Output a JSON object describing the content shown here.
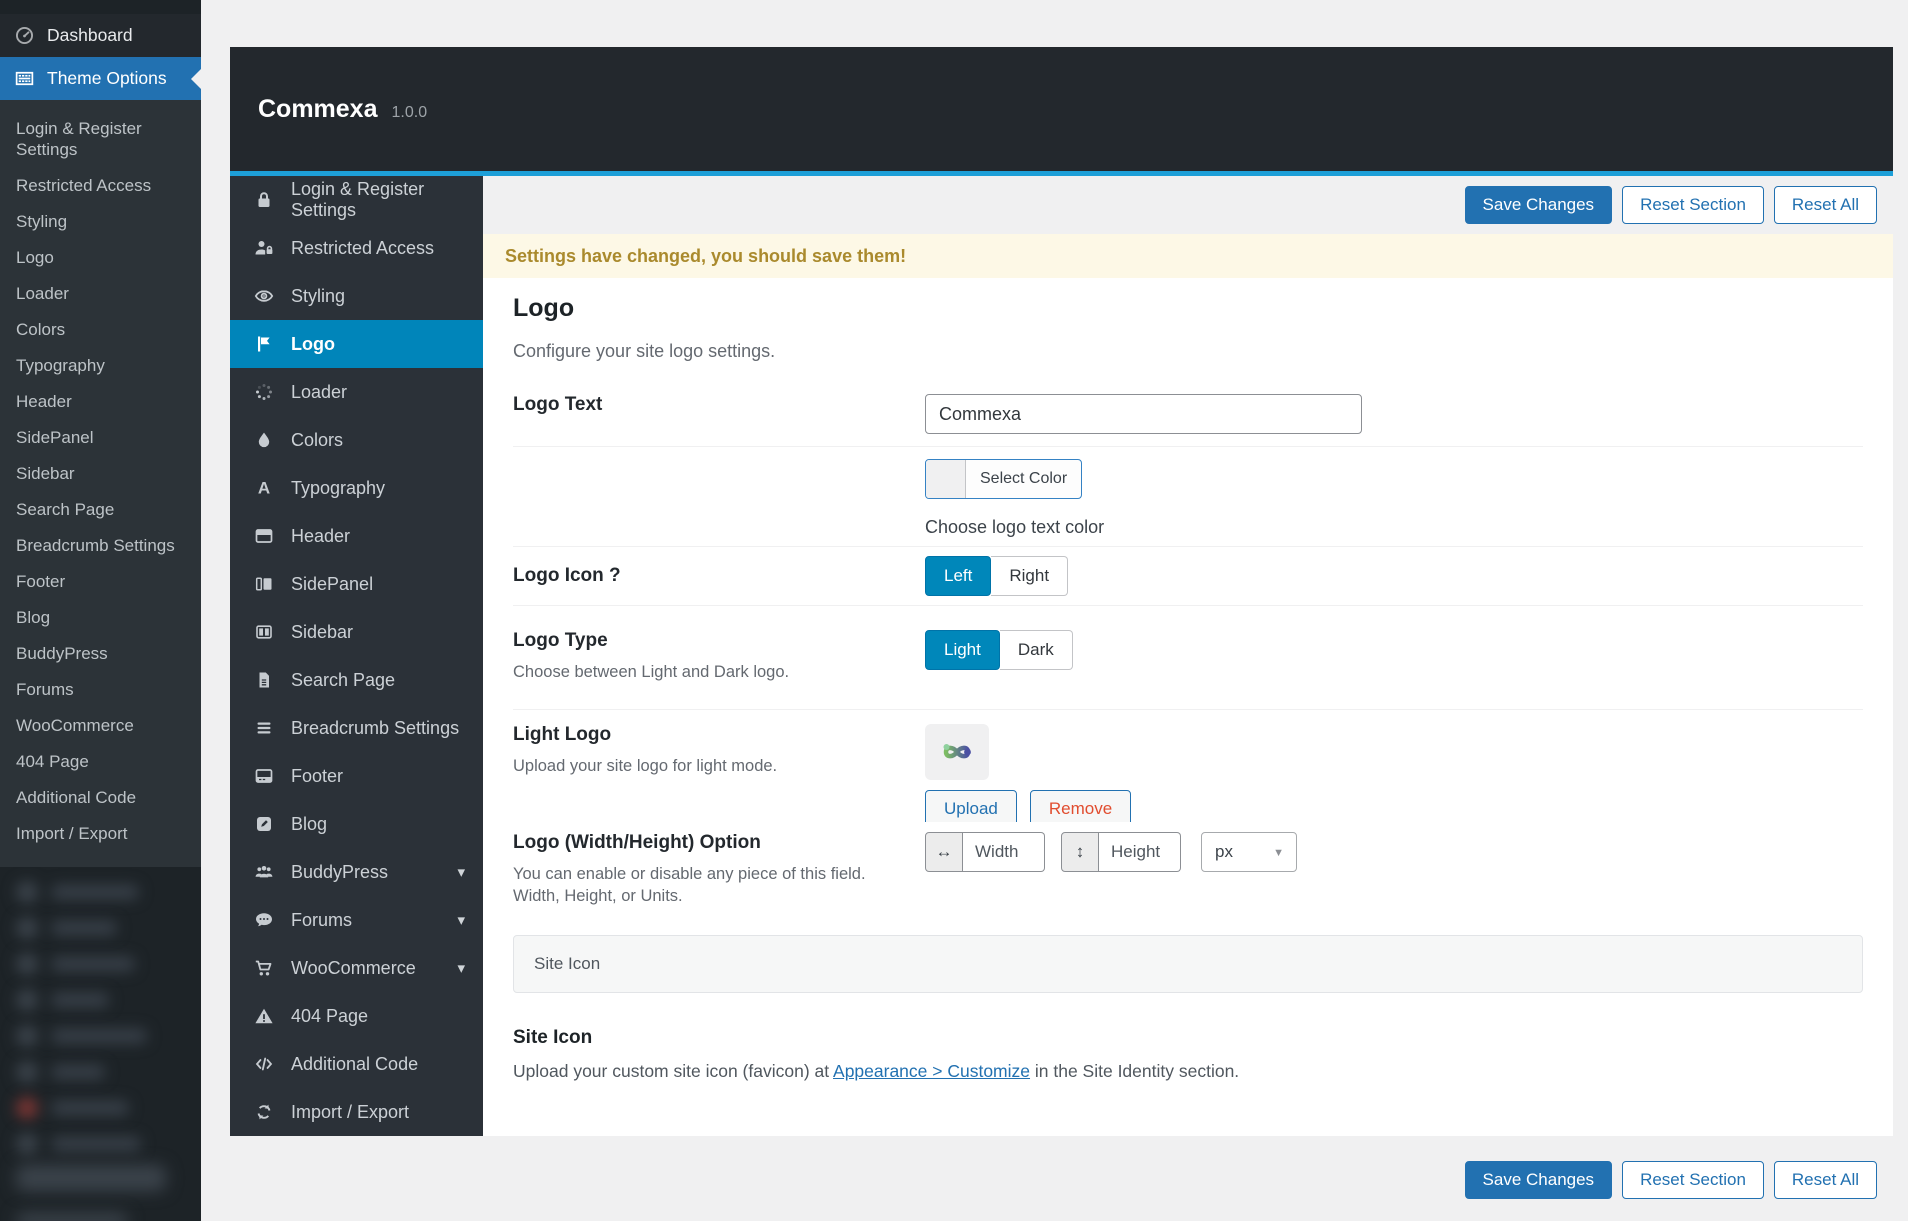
{
  "icons": {
    "chevron_down": "▾",
    "select_caret": "▼",
    "width_arrow": "↔",
    "height_arrow": "↕"
  },
  "admin_sidebar": {
    "dashboard": "Dashboard",
    "theme_options": "Theme Options",
    "submenu": [
      "Login & Register Settings",
      "Restricted Access",
      "Styling",
      "Logo",
      "Loader",
      "Colors",
      "Typography",
      "Header",
      "SidePanel",
      "Sidebar",
      "Search Page",
      "Breadcrumb Settings",
      "Footer",
      "Blog",
      "BuddyPress",
      "Forums",
      "WooCommerce",
      "404 Page",
      "Additional Code",
      "Import / Export"
    ]
  },
  "panel": {
    "title": "Commexa",
    "version": "1.0.0",
    "menu": [
      {
        "label": "Login & Register Settings",
        "icon": "lock-icon"
      },
      {
        "label": "Restricted Access",
        "icon": "user-lock-icon"
      },
      {
        "label": "Styling",
        "icon": "eye-icon"
      },
      {
        "label": "Logo",
        "icon": "flag-icon",
        "active": true
      },
      {
        "label": "Loader",
        "icon": "spinner-icon"
      },
      {
        "label": "Colors",
        "icon": "droplet-icon"
      },
      {
        "label": "Typography",
        "icon": "letter-a-icon"
      },
      {
        "label": "Header",
        "icon": "header-icon"
      },
      {
        "label": "SidePanel",
        "icon": "sidepanel-icon"
      },
      {
        "label": "Sidebar",
        "icon": "sidebar-columns-icon"
      },
      {
        "label": "Search Page",
        "icon": "document-icon"
      },
      {
        "label": "Breadcrumb Settings",
        "icon": "menu-lines-icon"
      },
      {
        "label": "Footer",
        "icon": "footer-icon"
      },
      {
        "label": "Blog",
        "icon": "pencil-icon"
      },
      {
        "label": "BuddyPress",
        "icon": "users-icon",
        "has_children": true
      },
      {
        "label": "Forums",
        "icon": "comment-icon",
        "has_children": true
      },
      {
        "label": "WooCommerce",
        "icon": "cart-icon",
        "has_children": true
      },
      {
        "label": "404 Page",
        "icon": "warning-icon"
      },
      {
        "label": "Additional Code",
        "icon": "code-icon"
      },
      {
        "label": "Import / Export",
        "icon": "sync-icon"
      }
    ],
    "toolbar": {
      "save": "Save Changes",
      "reset_section": "Reset Section",
      "reset_all": "Reset All"
    },
    "notice": "Settings have changed, you should save them!",
    "section": {
      "title": "Logo",
      "description": "Configure your site logo settings."
    },
    "fields": {
      "logo_text": {
        "label": "Logo Text",
        "value": "Commexa"
      },
      "logo_color": {
        "button": "Select Color",
        "help": "Choose logo text color"
      },
      "logo_icon": {
        "label": "Logo Icon ?",
        "left": "Left",
        "right": "Right",
        "selected": "Left"
      },
      "logo_type": {
        "label": "Logo Type",
        "description": "Choose between Light and Dark logo.",
        "light": "Light",
        "dark": "Dark",
        "selected": "Light"
      },
      "light_logo": {
        "label": "Light Logo",
        "description": "Upload your site logo for light mode.",
        "upload": "Upload",
        "remove": "Remove"
      },
      "dimensions": {
        "label": "Logo (Width/Height) Option",
        "description": "You can enable or disable any piece of this field. Width, Height, or Units.",
        "width_placeholder": "Width",
        "height_placeholder": "Height",
        "unit": "px"
      },
      "site_icon_bar": {
        "label": "Site Icon"
      },
      "site_icon": {
        "label": "Site Icon",
        "text_before": "Upload your custom site icon (favicon) at ",
        "link": "Appearance > Customize",
        "text_after": " in the Site Identity section."
      }
    }
  }
}
